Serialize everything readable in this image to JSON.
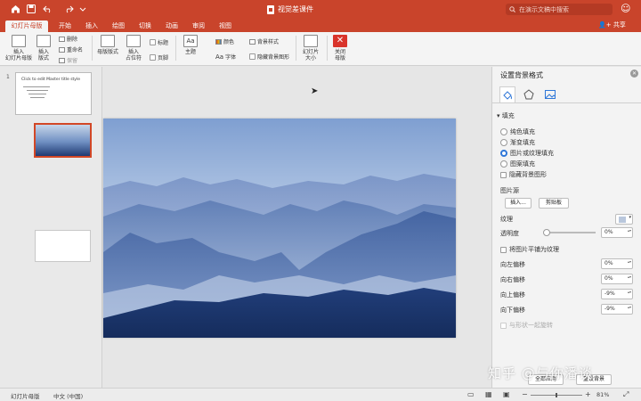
{
  "window": {
    "title": "视觉差课件",
    "search_placeholder": "在演示文稿中搜索"
  },
  "tabs": [
    {
      "label": "幻灯片母版"
    },
    {
      "label": "开始"
    },
    {
      "label": "插入"
    },
    {
      "label": "绘图"
    },
    {
      "label": "切换"
    },
    {
      "label": "动画"
    },
    {
      "label": "审阅"
    },
    {
      "label": "视图"
    }
  ],
  "share_label": "共享",
  "ribbon": {
    "insert_master": "插入\n幻灯片母版",
    "insert_layout": "插入\n版式",
    "delete": "删除",
    "rename": "重命名",
    "preserve": "保留",
    "master_layout": "母版版式",
    "insert_placeholder": "插入\n占位符",
    "title_chk": "标题",
    "footer_chk": "页脚",
    "theme": "主题",
    "colors": "颜色",
    "fonts": "字体",
    "bg_styles": "背景样式",
    "hide_bg": "隐藏背景图形",
    "slide_size": "幻灯片\n大小",
    "close_master": "关闭\n母版"
  },
  "thumbnails": {
    "number": "1",
    "master_title": "Click to edit Master title style"
  },
  "pane": {
    "title": "设置背景格式",
    "fill_section": "填充",
    "options": [
      {
        "label": "纯色填充",
        "selected": false
      },
      {
        "label": "渐变填充",
        "selected": false
      },
      {
        "label": "图片或纹理填充",
        "selected": true
      },
      {
        "label": "图案填充",
        "selected": false
      }
    ],
    "hide_bg_graphics": "隐藏背景图形",
    "picture_source": "图片源",
    "insert_btn": "插入...",
    "clipboard_btn": "剪贴板",
    "texture": "纹理",
    "transparency": "透明度",
    "transparency_value": "0%",
    "tile": "将图片平铺为纹理",
    "offsets": [
      {
        "label": "向左偏移",
        "value": "0%"
      },
      {
        "label": "向右偏移",
        "value": "0%"
      },
      {
        "label": "向上偏移",
        "value": "-9%"
      },
      {
        "label": "向下偏移",
        "value": "-9%"
      }
    ],
    "rotate_with_shape": "与形状一起旋转",
    "apply_all": "全部应用",
    "reset": "重设背景"
  },
  "status": {
    "view": "幻灯片母版",
    "language": "中文 (中国)",
    "zoom": "81%"
  },
  "watermark": "知乎 @与你潘谈",
  "colors": {
    "accent": "#c9442b",
    "radio_on": "#2f77d8",
    "close": "#d9342b"
  }
}
